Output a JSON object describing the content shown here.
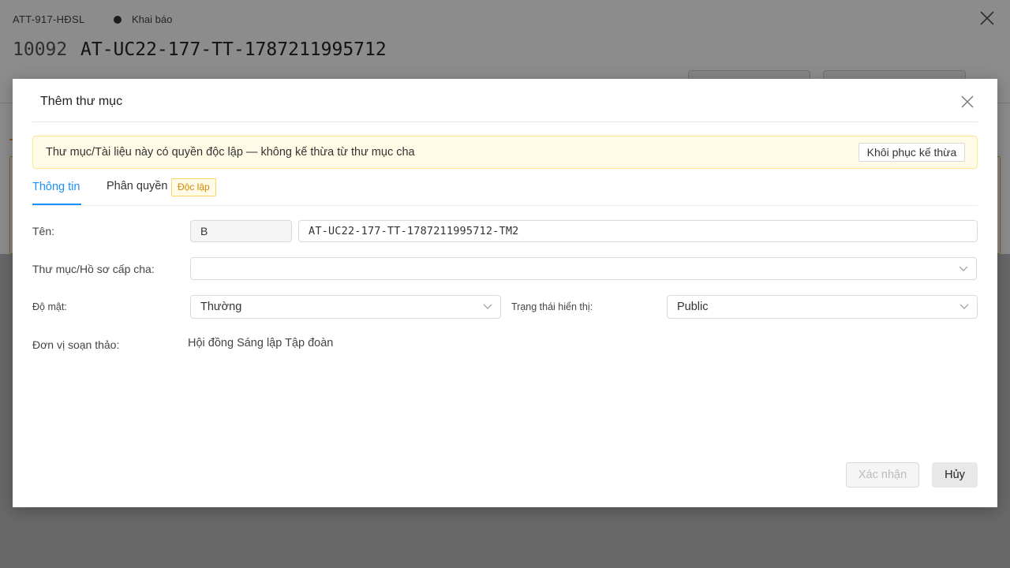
{
  "background": {
    "doc_code": "ATT-917-HĐSL",
    "status": "Khai báo",
    "doc_id": "10092",
    "doc_title": "AT-UC22-177-TT-1787211995712"
  },
  "modal": {
    "title": "Thêm thư mục",
    "alert": {
      "text": "Thư mục/Tài liệu này có quyền độc lập — không kế thừa từ thư mục cha",
      "restore_button": "Khôi phục kế thừa"
    },
    "tabs": {
      "info": "Thông tin",
      "permissions": "Phân quyền",
      "permissions_badge": "Độc lập"
    },
    "form": {
      "name_label": "Tên:",
      "name_prefix": "B",
      "name_value": "AT-UC22-177-TT-1787211995712-TM2",
      "parent_label": "Thư mục/Hồ sơ cấp cha:",
      "parent_value": "",
      "security_label": "Độ mật:",
      "security_value": "Thường",
      "display_status_label": "Trạng thái hiển thị:",
      "display_status_value": "Public",
      "unit_label": "Đơn vị soạn thảo:",
      "unit_value": "Hội đồng Sáng lập Tập đoàn"
    },
    "footer": {
      "confirm": "Xác nhận",
      "cancel": "Hủy"
    }
  }
}
